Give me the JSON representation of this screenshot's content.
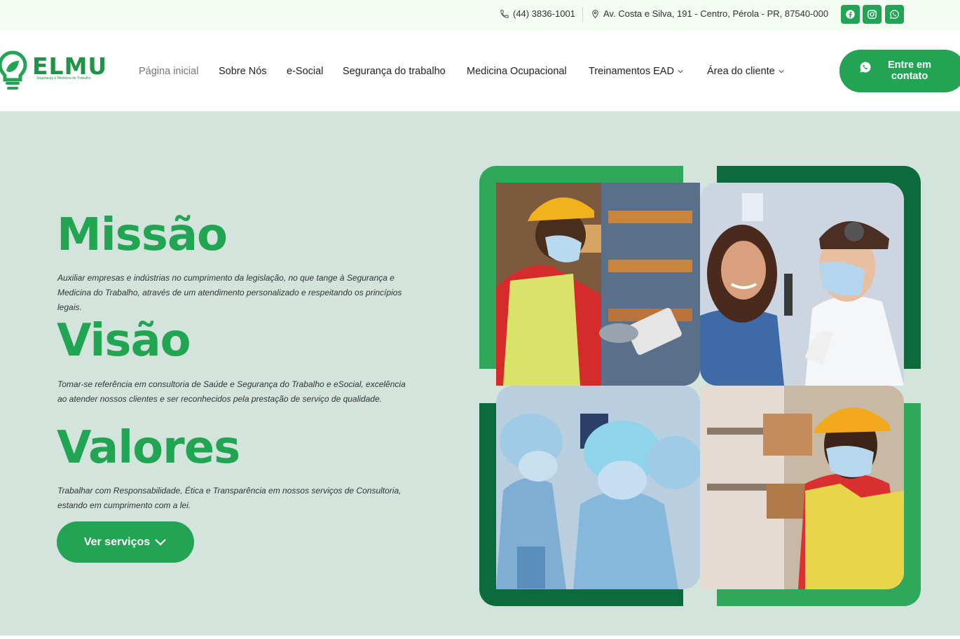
{
  "topbar": {
    "phone": "(44) 3836-1001",
    "address": "Av. Costa e Silva, 191 - Centro, Pérola - PR, 87540-000",
    "social": [
      "facebook-icon",
      "instagram-icon",
      "whatsapp-icon"
    ]
  },
  "header": {
    "logo_text": "ELMU",
    "logo_tagline": "Segurança e Medicina do Trabalho",
    "nav": {
      "home": "Página inicial",
      "about": "Sobre Nós",
      "esocial": "e-Social",
      "safety": "Segurança do trabalho",
      "medicine": "Medicina Ocupacional",
      "training": "Treinamentos EAD",
      "client_area": "Área do cliente"
    },
    "cta_label": "Entre em contato"
  },
  "hero": {
    "mission_title": "Missão",
    "mission_text": "Auxiliar empresas e indústrias no cumprimento da legislação, no que tange à Segurança e Medicina do Trabalho, através de um atendimento personalizado e respeitando os princípios legais.",
    "vision_title": "Visão",
    "vision_text": "Tomar-se referência em consultoria de Saúde e Segurança do Trabalho e eSocial, excelência ao atender nossos clientes e ser reconhecidos pela prestação de serviço de qualidade.",
    "values_title": "Valores",
    "values_text": "Trabalhar com Responsabilidade, Ética e Transparência em nossos serviços de Consultoria, estando em cumprimento com a lei.",
    "services_button": "Ver serviços"
  },
  "colors": {
    "green": "#23a455",
    "dark_green": "#0b6b3a",
    "hero_bg": "#d2e4dc",
    "topbar_bg": "#f3fbf3"
  }
}
